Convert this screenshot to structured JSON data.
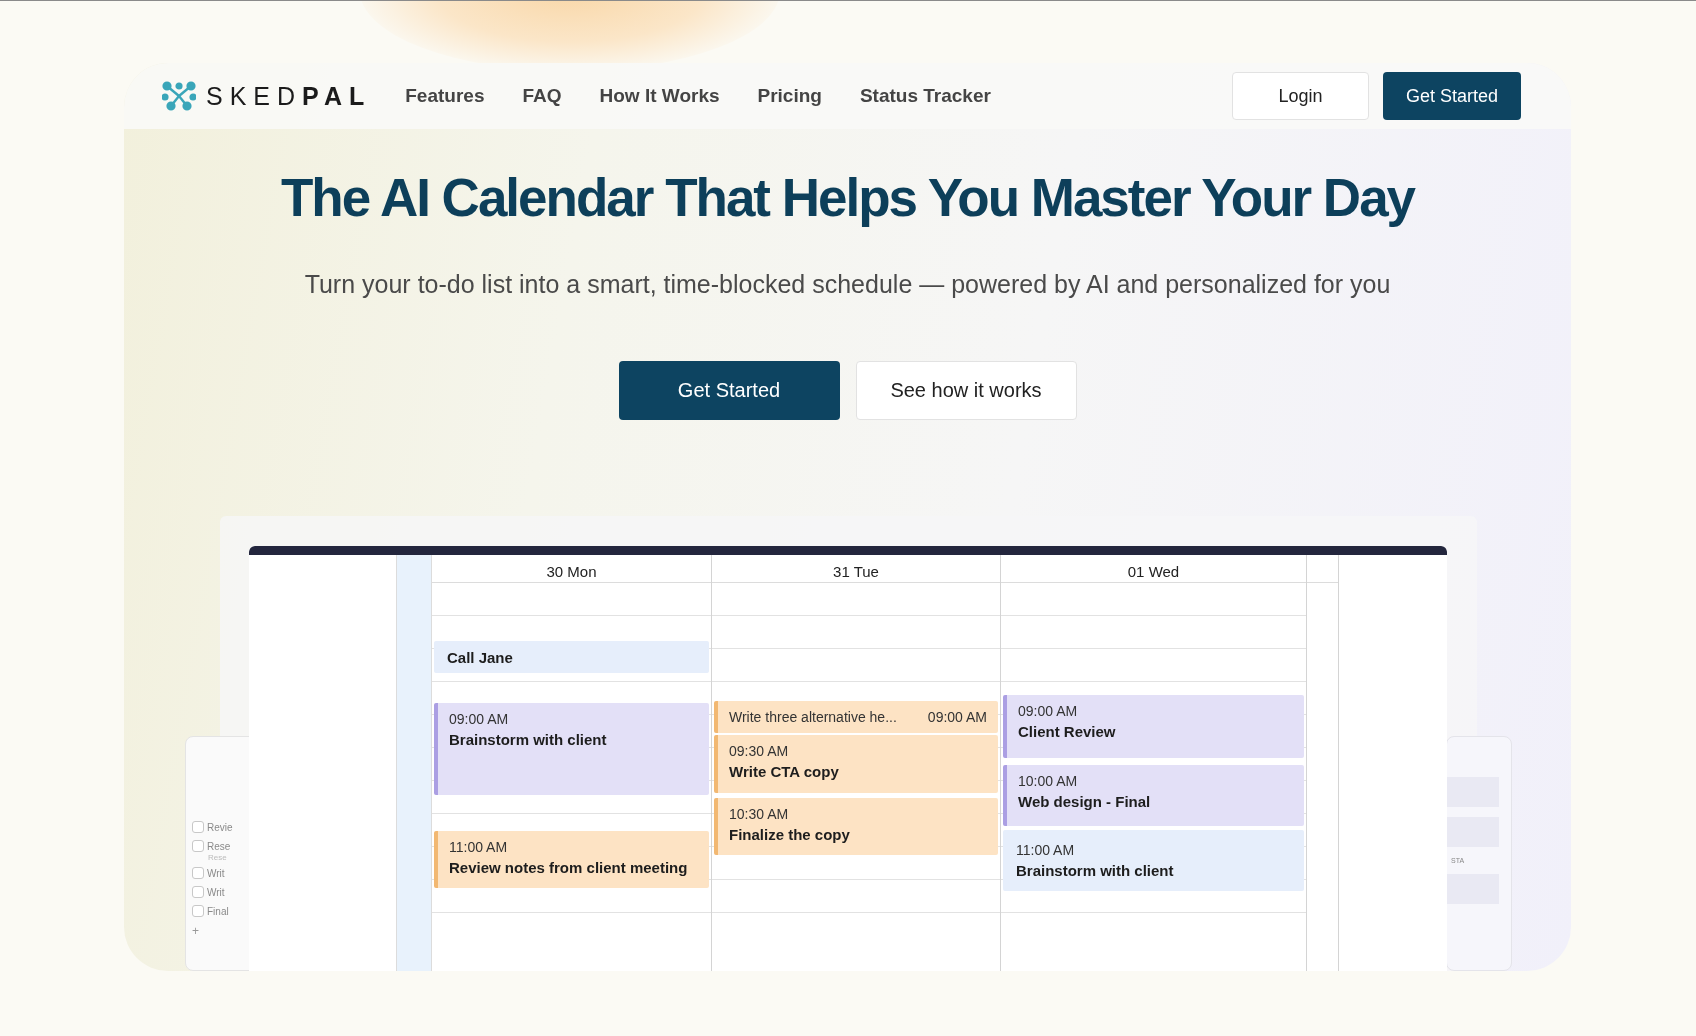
{
  "brand": {
    "name_light": "SKED",
    "name_bold": "PAL"
  },
  "nav": {
    "links": [
      "Features",
      "FAQ",
      "How It Works",
      "Pricing",
      "Status Tracker"
    ],
    "login": "Login",
    "cta": "Get Started"
  },
  "hero": {
    "title": "The AI Calendar That Helps You Master Your Day",
    "subtitle": "Turn your to-do list into a smart, time-blocked schedule — powered by AI and personalized for you",
    "primary": "Get Started",
    "secondary": "See how it works"
  },
  "task_panel": {
    "tasks": [
      {
        "label": "Revie",
        "checked": false
      },
      {
        "label": "Rese",
        "checked": false,
        "note": "Rese"
      },
      {
        "label": "Writ",
        "checked": false
      },
      {
        "label": "Writ",
        "checked": false
      },
      {
        "label": "Final",
        "checked": false
      }
    ],
    "add": "+"
  },
  "side_panel": {
    "label": "STA"
  },
  "calendar": {
    "days": [
      {
        "label": "30 Mon",
        "events": [
          {
            "title": "Call Jane",
            "color": "#e6eefb",
            "bar": false
          },
          {
            "time": "09:00 AM",
            "title": "Brainstorm with client",
            "color": "#e3e0f7",
            "bar": true
          },
          {
            "time": "11:00 AM",
            "title": "Review notes from client meeting",
            "color": "#fde3c4",
            "bar": true
          }
        ]
      },
      {
        "label": "31 Tue",
        "events": [
          {
            "title": "Write three alternative he...",
            "time": "09:00 AM",
            "inline": true,
            "color": "#fde3c4",
            "bar": true
          },
          {
            "time": "09:30 AM",
            "title": "Write CTA copy",
            "color": "#fde3c4",
            "bar": true
          },
          {
            "time": "10:30 AM",
            "title": "Finalize the copy",
            "color": "#fde3c4",
            "bar": true
          }
        ]
      },
      {
        "label": "01 Wed",
        "events": [
          {
            "time": "09:00 AM",
            "title": "Client Review",
            "color": "#e3e0f7",
            "bar": true
          },
          {
            "time": "10:00 AM",
            "title": "Web design - Final",
            "color": "#e3e0f7",
            "bar": true
          },
          {
            "time": "11:00 AM",
            "title": "Brainstorm with client",
            "color": "#e6eefb",
            "bar": false
          }
        ]
      }
    ]
  }
}
